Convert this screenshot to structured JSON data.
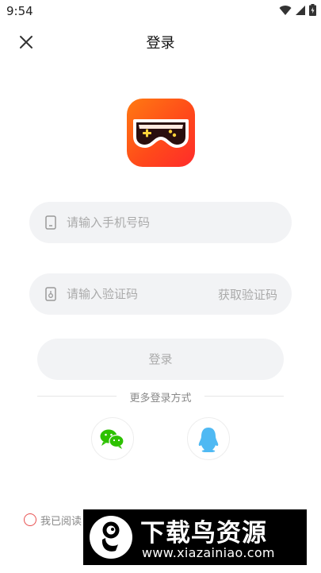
{
  "status_bar": {
    "time": "9:54"
  },
  "header": {
    "title": "登录"
  },
  "phone_field": {
    "placeholder": "请输入手机号码"
  },
  "code_field": {
    "placeholder": "请输入验证码",
    "get_code_label": "获取验证码"
  },
  "login_button": {
    "label": "登录"
  },
  "more_login": {
    "label": "更多登录方式"
  },
  "agreement": {
    "text": "我已阅读"
  },
  "watermark": {
    "title": "下载鸟资源",
    "url": "www.xiazainiao.com"
  },
  "colors": {
    "logo_gradient_start": "#ff7a12",
    "logo_gradient_end": "#ff2b2b",
    "wechat": "#2dc100",
    "qq": "#4fb9f3",
    "radio": "#e85050"
  },
  "icons": [
    "wifi-icon",
    "signal-icon",
    "battery-icon",
    "close-icon",
    "gamepad-logo-icon",
    "phone-icon",
    "lock-icon",
    "wechat-icon",
    "qq-icon"
  ]
}
